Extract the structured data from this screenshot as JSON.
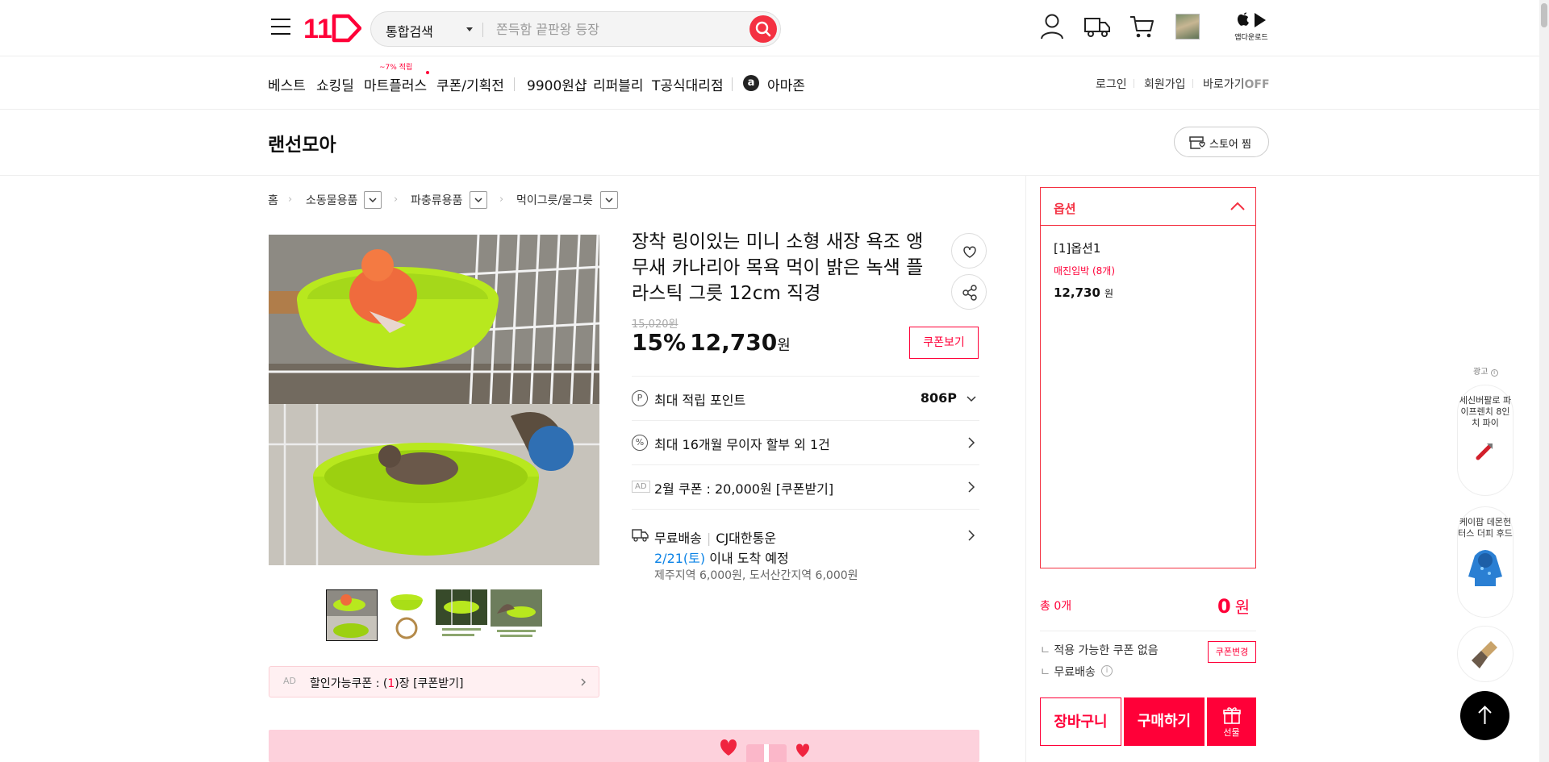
{
  "header": {
    "logo_text": "11",
    "search_scope": "통합검색",
    "search_placeholder": "쫀득함 끝판왕 등장",
    "app_download": "앱다운로드"
  },
  "nav": {
    "items": [
      "베스트",
      "쇼킹딜",
      "마트플러스",
      "쿠폰/기획전",
      "9900원샵",
      "리퍼블리",
      "T공식대리점",
      "아마존"
    ],
    "mart_badge": "~7% 적립",
    "utils": [
      "로그인",
      "회원가입",
      "바로가기"
    ],
    "shortcut_state": "OFF"
  },
  "store": {
    "name": "랜선모아",
    "follow_label": "스토어 찜"
  },
  "breadcrumb": [
    "홈",
    "소동물용품",
    "파충류용품",
    "먹이그릇/물그릇"
  ],
  "product": {
    "title": "장착 링이있는 미니 소형 새장 욕조 앵무새 카나리아 목욕 먹이 밝은 녹색 플라스틱 그릇 12cm 직경",
    "original_price": "15,020원",
    "discount": "15%",
    "price": "12,730",
    "price_unit": "원",
    "coupon_button": "쿠폰보기",
    "points_label": "최대 적립 포인트",
    "points_value": "806P",
    "installment_label": "최대 16개월 무이자 할부 외 1건",
    "ad_badge": "AD",
    "coupon_row_label": "2월 쿠폰 : 20,000원 [쿠폰받기]",
    "delivery_free": "무료배송",
    "delivery_carrier": "CJ대한통운",
    "arrival_date": "2/21(토)",
    "arrival_text": "이내 도착 예정",
    "delivery_extra": "제주지역 6,000원, 도서산간지역 6,000원",
    "coupon_banner_ad": "AD",
    "coupon_banner_prefix": "할인가능쿠폰 : (",
    "coupon_banner_count": "1",
    "coupon_banner_suffix": ")장 [쿠폰받기]"
  },
  "options": {
    "header": "옵션",
    "option_name": "[1]옵션1",
    "stock_note": "매진임박 (8개)",
    "option_price": "12,730",
    "option_unit": "원",
    "total_label": "총 0개",
    "total_value": "0",
    "total_unit": "원",
    "coupon_status": "적용 가능한 쿠폰 없음",
    "coupon_change": "쿠폰변경",
    "shipping": "무료배송",
    "cart_button": "장바구니",
    "buy_button": "구매하기",
    "gift_button": "선물"
  },
  "rail": {
    "ad_label": "광고",
    "item1": "세신버팔로 파이프렌치 8인치 파이",
    "item2": "케이팝 데몬헌터스 더피 후드"
  },
  "colors": {
    "brand_red": "#f43142",
    "brand_pink": "#ff0038",
    "delivery_blue": "#0b83e6"
  }
}
